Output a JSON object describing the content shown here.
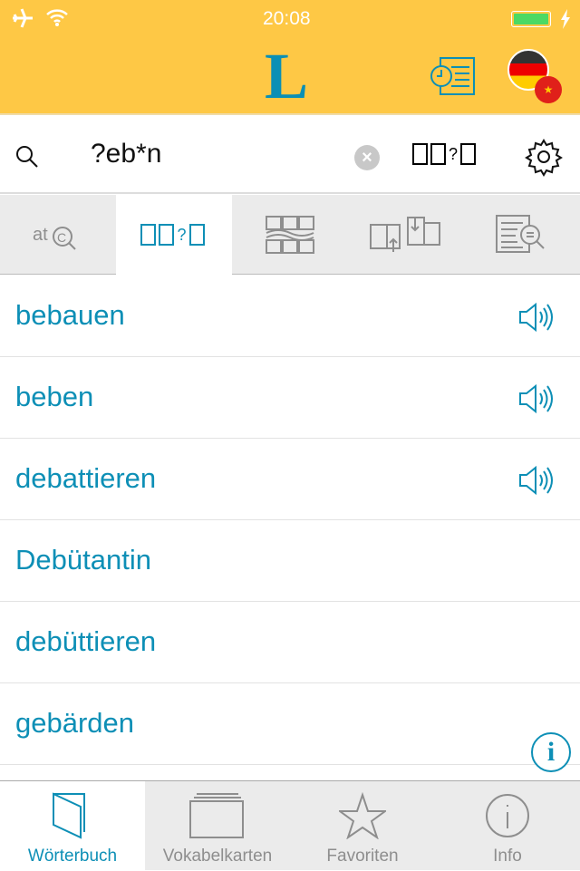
{
  "status": {
    "time": "20:08",
    "battery_color": "#4cd964"
  },
  "header": {
    "logo": "L",
    "history_icon": "history-icon",
    "language_pair": "German-Chinese"
  },
  "search": {
    "query": "?eb*n",
    "wildcard_label": "□□?□"
  },
  "modes": [
    {
      "name": "spelling-search",
      "selected": false
    },
    {
      "name": "wildcard-search",
      "label": "□□?□",
      "selected": true
    },
    {
      "name": "fuzzy-search",
      "selected": false
    },
    {
      "name": "inflection-search",
      "selected": false
    },
    {
      "name": "fulltext-search",
      "selected": false
    }
  ],
  "results": [
    {
      "word": "bebauen",
      "audio": true
    },
    {
      "word": "beben",
      "audio": true
    },
    {
      "word": "debattieren",
      "audio": true
    },
    {
      "word": "Debütantin",
      "audio": false
    },
    {
      "word": "debüttieren",
      "audio": false
    },
    {
      "word": "gebärden",
      "audio": false
    }
  ],
  "info_button": "i",
  "tabs": [
    {
      "label": "Wörterbuch",
      "selected": true
    },
    {
      "label": "Vokabelkarten",
      "selected": false
    },
    {
      "label": "Favoriten",
      "selected": false
    },
    {
      "label": "Info",
      "selected": false
    }
  ],
  "accent_color": "#0d8fb6",
  "header_color": "#FEC845"
}
